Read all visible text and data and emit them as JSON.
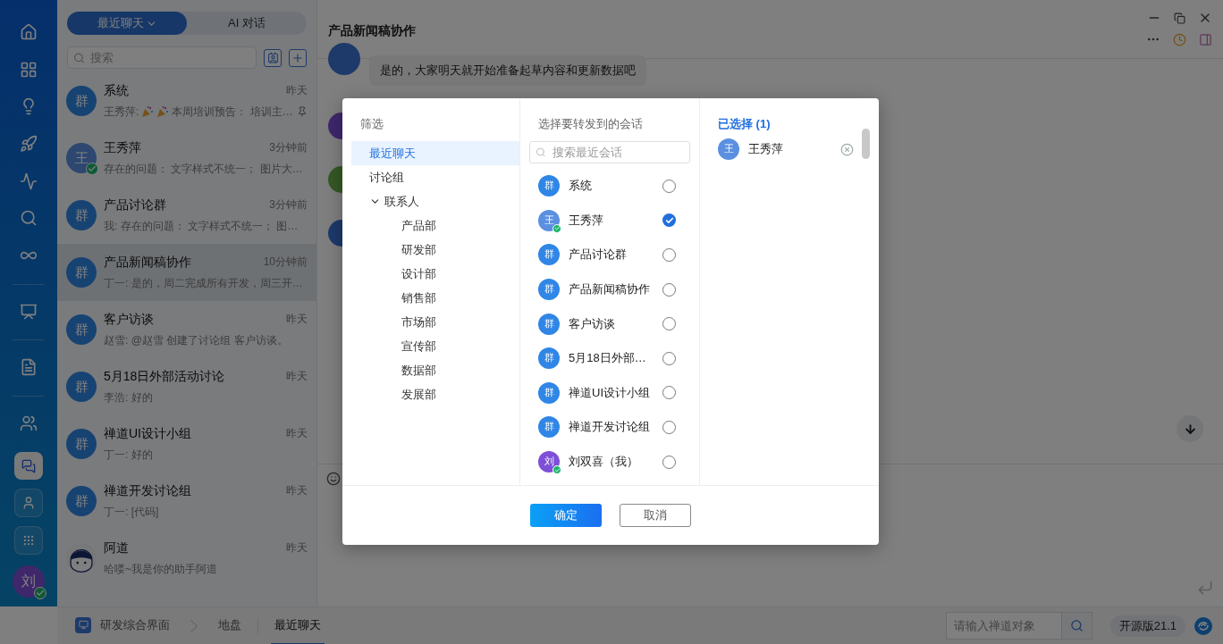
{
  "sidebar": {
    "user_avatar": {
      "text": "刘",
      "online": true
    }
  },
  "conversation_panel": {
    "tabs": [
      {
        "label": "最近聊天",
        "selected": true,
        "dropdown": true
      },
      {
        "label": "AI 对话",
        "selected": false,
        "dropdown": false
      }
    ],
    "search": {
      "placeholder": "搜索"
    },
    "conversations": [
      {
        "kind": "group",
        "avatar": "群",
        "name": "系统",
        "time": "昨天",
        "sender": "王秀萍:",
        "party_icons": true,
        "preview": "本周培训预告： 培训主…",
        "pinned": true,
        "online": false,
        "selected": false
      },
      {
        "kind": "user",
        "avatar": "王",
        "name": "王秀萍",
        "time": "3分钟前",
        "preview": "存在的问题： 文字样式不统一； 图片大…",
        "pinned": false,
        "online": true,
        "selected": false
      },
      {
        "kind": "group",
        "avatar": "群",
        "name": "产品讨论群",
        "time": "3分钟前",
        "preview": "我: 存在的问题： 文字样式不统一； 图…",
        "pinned": false,
        "online": false,
        "selected": false
      },
      {
        "kind": "group",
        "avatar": "群",
        "name": "产品新闻稿协作",
        "time": "10分钟前",
        "preview": "丁一: 是的，周二完成所有开发，周三开…",
        "pinned": false,
        "online": false,
        "selected": true
      },
      {
        "kind": "group",
        "avatar": "群",
        "name": "客户访谈",
        "time": "昨天",
        "preview": "赵雪: @赵雪 创建了讨论组 客户访谈。",
        "pinned": false,
        "online": false,
        "selected": false
      },
      {
        "kind": "group",
        "avatar": "群",
        "name": "5月18日外部活动讨论",
        "time": "昨天",
        "preview": "李浩: 好的",
        "pinned": false,
        "online": false,
        "selected": false
      },
      {
        "kind": "group",
        "avatar": "群",
        "name": "禅道UI设计小组",
        "time": "昨天",
        "preview": "丁一: 好的",
        "pinned": false,
        "online": false,
        "selected": false
      },
      {
        "kind": "group",
        "avatar": "群",
        "name": "禅道开发讨论组",
        "time": "昨天",
        "preview": "丁一: [代码]",
        "pinned": false,
        "online": false,
        "selected": false
      },
      {
        "kind": "bot",
        "name": "阿道",
        "time": "昨天",
        "preview": "哈喽~我是你的助手阿道",
        "pinned": false,
        "online": false,
        "selected": false
      }
    ]
  },
  "chat": {
    "title": "产品新闻稿协作",
    "message": "是的，大家明天就开始准备起草内容和更新数据吧"
  },
  "status_bar": {
    "breadcrumbs": [
      {
        "label": "研发综合界面",
        "kind": "app",
        "selected": false
      },
      {
        "label": "地盘",
        "kind": "page",
        "selected": false
      },
      {
        "label": "最近聊天",
        "kind": "page",
        "selected": true
      }
    ],
    "search": {
      "placeholder": "请输入禅道对象"
    },
    "version": "开源版21.1"
  },
  "dialog": {
    "filter": {
      "title": "筛选",
      "items": [
        {
          "label": "最近聊天",
          "selected": true
        },
        {
          "label": "讨论组",
          "selected": false
        },
        {
          "label": "联系人",
          "selected": false,
          "expanded": true,
          "children": [
            {
              "label": "产品部",
              "selected": false
            },
            {
              "label": "研发部",
              "selected": false
            },
            {
              "label": "设计部",
              "selected": false
            },
            {
              "label": "销售部",
              "selected": false
            },
            {
              "label": "市场部",
              "selected": false
            },
            {
              "label": "宣传部",
              "selected": false
            },
            {
              "label": "数据部",
              "selected": false
            },
            {
              "label": "发展部",
              "selected": false
            }
          ]
        }
      ]
    },
    "targets": {
      "title": "选择要转发到的会话",
      "search": {
        "placeholder": "搜索最近会话"
      },
      "items": [
        {
          "kind": "group",
          "avatar": "群",
          "name": "系统",
          "online": false,
          "checked": false
        },
        {
          "kind": "user",
          "avatar": "王",
          "name": "王秀萍",
          "online": true,
          "checked": true
        },
        {
          "kind": "group",
          "avatar": "群",
          "name": "产品讨论群",
          "online": false,
          "checked": false
        },
        {
          "kind": "group",
          "avatar": "群",
          "name": "产品新闻稿协作",
          "online": false,
          "checked": false
        },
        {
          "kind": "group",
          "avatar": "群",
          "name": "客户访谈",
          "online": false,
          "checked": false
        },
        {
          "kind": "group",
          "avatar": "群",
          "name": "5月18日外部…",
          "online": false,
          "checked": false
        },
        {
          "kind": "group",
          "avatar": "群",
          "name": "禅道UI设计小组",
          "online": false,
          "checked": false
        },
        {
          "kind": "group",
          "avatar": "群",
          "name": "禅道开发讨论组",
          "online": false,
          "checked": false
        },
        {
          "kind": "me",
          "avatar": "刘",
          "name": "刘双喜（我）",
          "online": true,
          "checked": false
        }
      ]
    },
    "chosen": {
      "title": "已选择 (1)",
      "items": [
        {
          "avatar": "王",
          "name": "王秀萍"
        }
      ]
    },
    "buttons": [
      {
        "label": "确定",
        "kind": "primary"
      },
      {
        "label": "取消",
        "kind": "secondary"
      }
    ]
  }
}
